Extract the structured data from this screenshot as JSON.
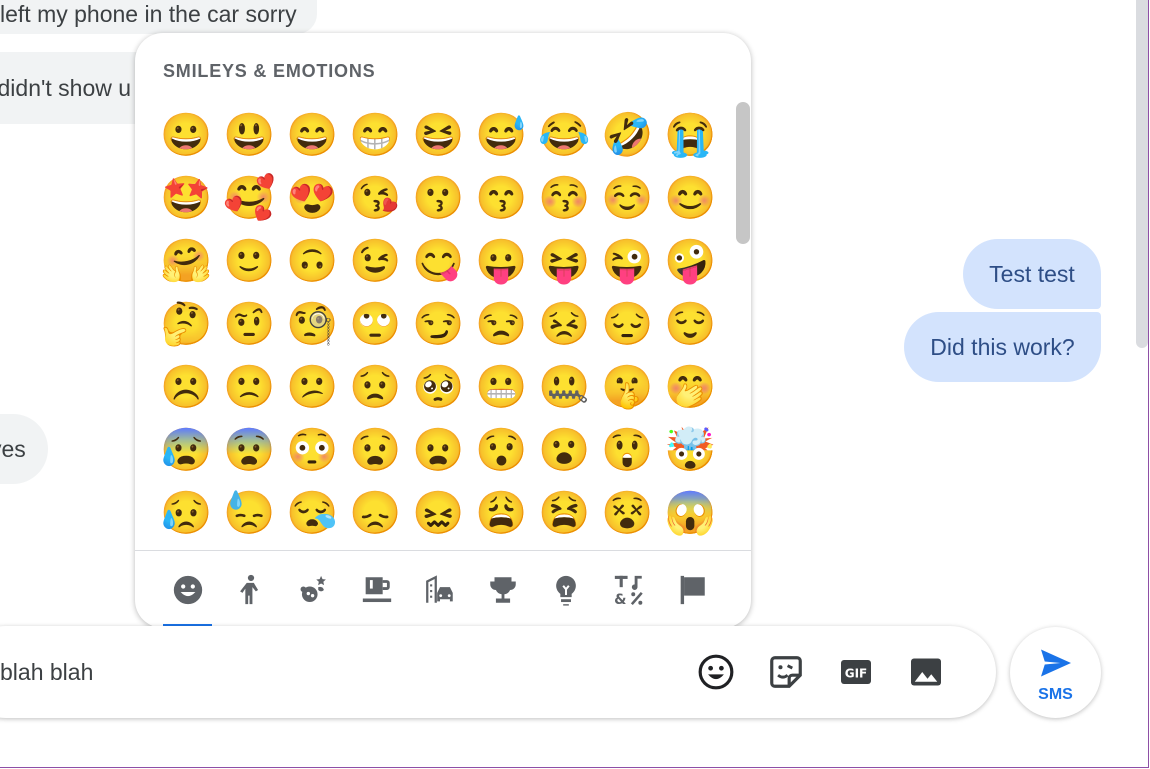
{
  "conversation": {
    "incoming": [
      "left my phone in the car sorry",
      "i didn't show u",
      "yes"
    ],
    "outgoing": [
      "Test test",
      "Did this work?"
    ]
  },
  "emoji_picker": {
    "title": "SMILEYS & EMOTIONS",
    "emojis": [
      "😀",
      "😃",
      "😄",
      "😁",
      "😆",
      "😅",
      "😂",
      "🤣",
      "😭",
      "🤩",
      "🥰",
      "😍",
      "😘",
      "😗",
      "😙",
      "😚",
      "☺️",
      "😊",
      "🤗",
      "🙂",
      "🙃",
      "😉",
      "😋",
      "😛",
      "😝",
      "😜",
      "🤪",
      "🤔",
      "🤨",
      "🧐",
      "🙄",
      "😏",
      "😒",
      "😣",
      "😔",
      "😌",
      "☹️",
      "🙁",
      "😕",
      "😟",
      "🥺",
      "😬",
      "🤐",
      "🤫",
      "🤭",
      "😰",
      "😨",
      "😳",
      "😧",
      "😦",
      "😯",
      "😮",
      "😲",
      "🤯",
      "😥",
      "😓",
      "😪",
      "😞",
      "😖",
      "😩",
      "😫",
      "😵",
      "😱"
    ],
    "categories": [
      {
        "name": "smileys",
        "icon": "smiley-face-icon",
        "active": true
      },
      {
        "name": "people",
        "icon": "person-icon",
        "active": false
      },
      {
        "name": "animals-nature",
        "icon": "animals-nature-icon",
        "active": false
      },
      {
        "name": "food-drink",
        "icon": "food-drink-icon",
        "active": false
      },
      {
        "name": "travel-places",
        "icon": "building-car-icon",
        "active": false
      },
      {
        "name": "activities",
        "icon": "trophy-icon",
        "active": false
      },
      {
        "name": "objects",
        "icon": "lightbulb-icon",
        "active": false
      },
      {
        "name": "symbols",
        "icon": "symbols-icon",
        "active": false
      },
      {
        "name": "flags",
        "icon": "flag-icon",
        "active": false
      }
    ]
  },
  "composer": {
    "input_value": "blah blah",
    "tools": [
      "emoji-icon",
      "sticker-icon",
      "gif-icon",
      "image-icon"
    ]
  },
  "send": {
    "label": "SMS"
  },
  "colors": {
    "accent": "#1a73e8",
    "incoming_bubble": "#f1f3f4",
    "outgoing_bubble": "#d3e3fd",
    "icon_gray": "#5f6368"
  }
}
